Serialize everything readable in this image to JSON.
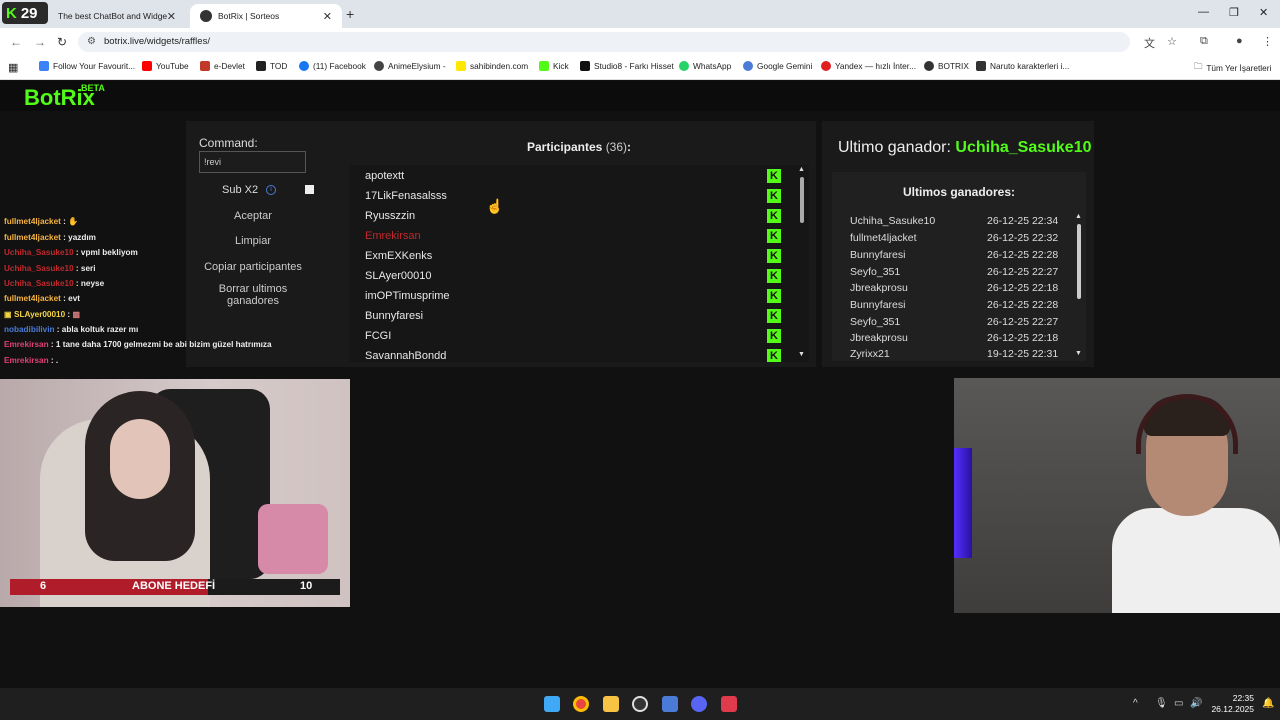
{
  "browser": {
    "badge_number": "29",
    "tabs": [
      {
        "title": "The best ChatBot and Widgets"
      },
      {
        "title": "BotRix | Sorteos"
      }
    ],
    "url": "botrix.live/widgets/raffles/",
    "bookmarks": [
      {
        "label": "Follow Your Favourit...",
        "color": "#3b82f6"
      },
      {
        "label": "YouTube",
        "color": "#ff0000"
      },
      {
        "label": "e-Devlet",
        "color": "#c0392b"
      },
      {
        "label": "TOD",
        "color": "#222222"
      },
      {
        "label": "(11) Facebook",
        "color": "#1877f2"
      },
      {
        "label": "AnimeElysium -",
        "color": "#444444"
      },
      {
        "label": "sahibinden.com",
        "color": "#ffe800"
      },
      {
        "label": "Kick",
        "color": "#53fc18"
      },
      {
        "label": "Studio8 - Farkı Hisset",
        "color": "#111111"
      },
      {
        "label": "WhatsApp",
        "color": "#25d366"
      },
      {
        "label": "Google Gemini",
        "color": "#4a7bd6"
      },
      {
        "label": "Yandex — hızlı İnter...",
        "color": "#e02020"
      },
      {
        "label": "BOTRIX",
        "color": "#333333"
      },
      {
        "label": "Naruto karakterleri i...",
        "color": "#333333"
      }
    ],
    "all_bookmarks": "Tüm Yer İşaretleri"
  },
  "app": {
    "brand": "BotRix",
    "brand_tag": "BETA",
    "accent": "#53fc18",
    "command_label": "Command:",
    "command_value": "!revi",
    "sub_label": "Sub X2",
    "buttons": {
      "accept": "Aceptar",
      "clear": "Limpiar",
      "copy": "Copiar participantes",
      "delete_line1": "Borrar ultimos",
      "delete_line2": "ganadores"
    },
    "participants_title": "Participantes",
    "participants_count": "(36)",
    "participants_colon": ":",
    "participants": [
      {
        "name": "apotextt",
        "winner": false
      },
      {
        "name": "17LikFenasalsss",
        "winner": false
      },
      {
        "name": "Ryusszzin",
        "winner": false
      },
      {
        "name": "Emrekirsan",
        "winner": true
      },
      {
        "name": "ExmEXKenks",
        "winner": false
      },
      {
        "name": "SLAyer00010",
        "winner": false
      },
      {
        "name": "imOPTimusprime",
        "winner": false
      },
      {
        "name": "Bunnyfaresi",
        "winner": false
      },
      {
        "name": "FCGI",
        "winner": false
      },
      {
        "name": "SavannahBondd",
        "winner": false
      }
    ],
    "last_winner_label": "Ultimo ganador:",
    "last_winner_name": "Uchiha_Sasuke10",
    "winners_title": "Ultimos ganadores:",
    "winners": [
      {
        "name": "Uchiha_Sasuke10",
        "date": "26-12-25 22:34"
      },
      {
        "name": "fullmet4ljacket",
        "date": "26-12-25 22:32"
      },
      {
        "name": "Bunnyfaresi",
        "date": "26-12-25 22:28"
      },
      {
        "name": "Seyfo_351",
        "date": "26-12-25 22:27"
      },
      {
        "name": "Jbreakprosu",
        "date": "26-12-25 22:18"
      },
      {
        "name": "Bunnyfaresi",
        "date": "26-12-25 22:28"
      },
      {
        "name": "Seyfo_351",
        "date": "26-12-25 22:27"
      },
      {
        "name": "Jbreakprosu",
        "date": "26-12-25 22:18"
      },
      {
        "name": "Zyrixx21",
        "date": "19-12-25 22:31"
      }
    ]
  },
  "chat": [
    {
      "user": "fullmet4ljacket",
      "sep": " : ",
      "text": "",
      "color": "#f5b342"
    },
    {
      "user": "fullmet4ljacket",
      "sep": " : ",
      "text": "yazdım",
      "color": "#f5b342"
    },
    {
      "user": "Uchiha_Sasuke10",
      "sep": " : ",
      "text": "vpml bekliyom",
      "color": "#c0282d"
    },
    {
      "user": "Uchiha_Sasuke10",
      "sep": " : ",
      "text": "seri",
      "color": "#c0282d"
    },
    {
      "user": "Uchiha_Sasuke10",
      "sep": " : ",
      "text": "neyse",
      "color": "#c0282d"
    },
    {
      "user": "fullmet4ljacket",
      "sep": " : ",
      "text": "evt",
      "color": "#f5b342"
    },
    {
      "user": "SLAyer00010",
      "sep": " : ",
      "text": "",
      "color": "#f5d442"
    },
    {
      "user": "nobadibilivin",
      "sep": " : ",
      "text": "abla koltuk razer mı",
      "color": "#4a7bd6"
    },
    {
      "user": "Emrekirsan",
      "sep": " : ",
      "text": "1 tane daha 1700 gelmezmi be abi bizim güzel hatrımıza",
      "color": "#e0407a"
    },
    {
      "user": "Emrekirsan",
      "sep": " : ",
      "text": ".",
      "color": "#e0407a"
    }
  ],
  "goal": {
    "current": "6",
    "label": "ABONE HEDEFİ",
    "target": "10",
    "progress": 0.6
  },
  "taskbar": {
    "time": "22:35",
    "date": "26.12.2025"
  }
}
